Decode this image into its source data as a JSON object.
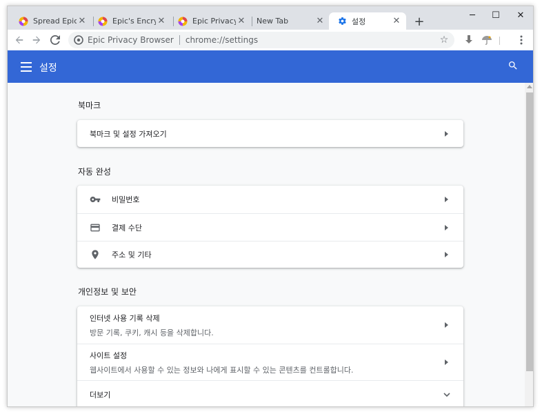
{
  "tabs": [
    {
      "title": "Spread Epic",
      "icon": "epic-logo-icon"
    },
    {
      "title": "Epic's Encrypt",
      "icon": "epic-logo-icon"
    },
    {
      "title": "Epic Privacy B",
      "icon": "epic-logo-icon"
    },
    {
      "title": "New Tab",
      "icon": ""
    },
    {
      "title": "설정",
      "icon": "gear-icon",
      "active": true
    }
  ],
  "window_controls": {
    "minimize": "─",
    "maximize": "☐",
    "close": "✕"
  },
  "omnibox": {
    "brand": "Epic Privacy Browser",
    "url": "chrome://settings"
  },
  "appbar": {
    "title": "설정"
  },
  "sections": {
    "bookmarks": {
      "title": "북마크",
      "items": [
        {
          "label": "북마크 및 설정 가져오기"
        }
      ]
    },
    "autofill": {
      "title": "자동 완성",
      "items": [
        {
          "label": "비밀번호",
          "icon": "key-icon"
        },
        {
          "label": "결제 수단",
          "icon": "credit-card-icon"
        },
        {
          "label": "주소 및 기타",
          "icon": "location-pin-icon"
        }
      ]
    },
    "privacy": {
      "title": "개인정보 및 보안",
      "items": [
        {
          "label": "인터넷 사용 기록 삭제",
          "sublabel": "방문 기록, 쿠키, 캐시 등을 삭제합니다."
        },
        {
          "label": "사이트 설정",
          "sublabel": "웹사이트에서 사용할 수 있는 정보와 나에게 표시할 수 있는 콘텐츠를 컨트롤합니다."
        },
        {
          "label": "더보기"
        }
      ]
    }
  },
  "colors": {
    "accent": "#3367d6",
    "epic_logo": "#e0474c"
  }
}
